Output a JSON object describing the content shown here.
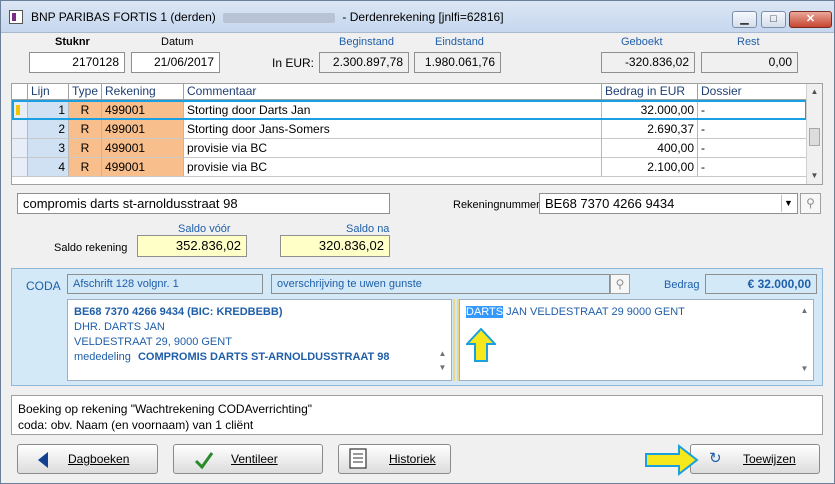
{
  "window": {
    "title_prefix": "BNP PARIBAS FORTIS 1 (derden)",
    "title_suffix": "- Derdenrekening [jnlfi=62816]"
  },
  "header": {
    "stuknr_label": "Stuknr",
    "stuknr_value": "2170128",
    "datum_label": "Datum",
    "datum_value": "21/06/2017",
    "in_eur_label": "In EUR:",
    "beginstand_label": "Beginstand",
    "beginstand_value": "2.300.897,78",
    "eindstand_label": "Eindstand",
    "eindstand_value": "1.980.061,76",
    "geboekt_label": "Geboekt",
    "geboekt_value": "-320.836,02",
    "rest_label": "Rest",
    "rest_value": "0,00"
  },
  "grid": {
    "columns": [
      "Lijn",
      "Type",
      "Rekening",
      "Commentaar",
      "Bedrag in EUR",
      "Dossier"
    ],
    "rows": [
      {
        "lijn": "1",
        "type": "R",
        "rekening": "499001",
        "commentaar": "Storting door Darts Jan",
        "bedrag": "32.000,00",
        "dossier": "-"
      },
      {
        "lijn": "2",
        "type": "R",
        "rekening": "499001",
        "commentaar": "Storting door Jans-Somers",
        "bedrag": "2.690,37",
        "dossier": "-"
      },
      {
        "lijn": "3",
        "type": "R",
        "rekening": "499001",
        "commentaar": "provisie via BC",
        "bedrag": "400,00",
        "dossier": "-"
      },
      {
        "lijn": "4",
        "type": "R",
        "rekening": "499001",
        "commentaar": "provisie via BC",
        "bedrag": "2.100,00",
        "dossier": "-"
      }
    ]
  },
  "detail": {
    "comment_value": "compromis darts  st-arnoldusstraat 98",
    "rekeningnummer_label": "Rekeningnummer",
    "rekeningnummer_value": "BE68 7370 4266 9434",
    "saldo_voor_label": "Saldo vóór",
    "saldo_na_label": "Saldo na",
    "saldo_rekening_label": "Saldo rekening",
    "saldo_voor_value": "352.836,02",
    "saldo_na_value": "320.836,02"
  },
  "coda": {
    "label": "CODA",
    "afschrift": "Afschrift 128  volgnr. 1",
    "omschrijving": "overschrijving te uwen gunste",
    "bedrag_label": "Bedrag",
    "bedrag_value": "€ 32.000,00",
    "left_lines": [
      "BE68 7370 4266 9434 (BIC: KREDBEBB)",
      "DHR. DARTS JAN",
      "VELDESTRAAT 29, 9000 GENT"
    ],
    "mededeling_label": "mededeling",
    "mededeling_value": "COMPROMIS DARTS  ST-ARNOLDUSSTRAAT 98",
    "right_highlight": "DARTS",
    "right_rest": " JAN  VELDESTRAAT 29  9000 GENT"
  },
  "info": {
    "line1": "Boeking op rekening \"Wachtrekening CODAverrichting\"",
    "line2": "coda: obv. Naam (en voornaam) van 1 cliënt"
  },
  "buttons": {
    "dagboeken": "Dagboeken",
    "ventileer": "Ventileer",
    "historiek": "Historiek",
    "toewijzen": "Toewijzen"
  },
  "colors": {
    "accent_blue": "#1f5ea8",
    "selection_frame": "#1a9fe0",
    "rekening_cell": "#f8be8c",
    "saldo_yellow": "#ffffc8",
    "coda_panel": "#d3e9f8",
    "hint_arrow": "#f7e81e"
  },
  "icons": {
    "app": "app-icon",
    "minimize": "minimize-icon",
    "maximize": "maximize-icon",
    "close": "close-icon",
    "pin": "pin-icon",
    "dagboeken": "triangle-left-icon",
    "ventileer": "checkmark-icon",
    "historiek": "document-icon",
    "toewijzen": "refresh-icon"
  }
}
